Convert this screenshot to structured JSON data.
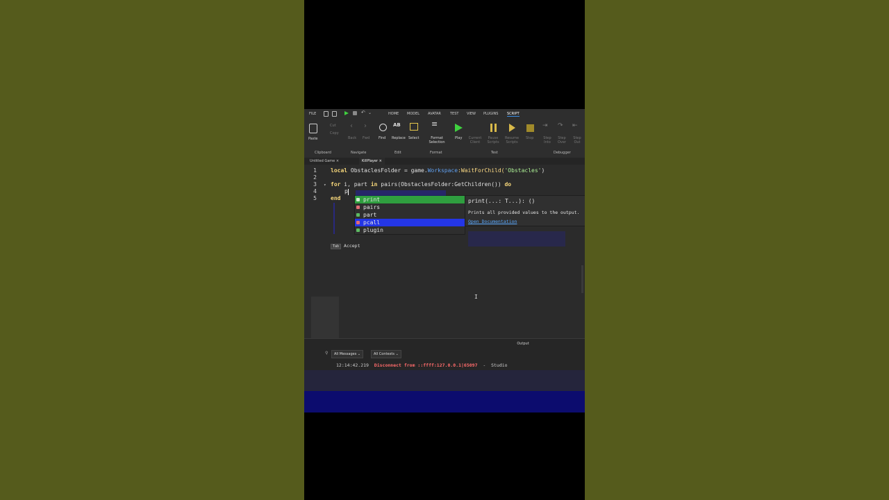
{
  "menu": {
    "file": "FILE",
    "tabs": [
      "HOME",
      "MODEL",
      "AVATAR",
      "TEST",
      "VIEW",
      "PLUGINS",
      "SCRIPT"
    ],
    "active": "SCRIPT"
  },
  "ribbon": {
    "paste": "Paste",
    "cut": "Cut",
    "copy": "Copy",
    "back": "Back",
    "fwd": "Fwd",
    "find": "Find",
    "replace": "Replace",
    "select": "Select",
    "format_selection": "Format Selection",
    "play": "Play",
    "current_client": "Current Client",
    "pause_scripts": "Pause Scripts",
    "resume_scripts": "Resume Scripts",
    "stop": "Stop",
    "step_into": "Step Into",
    "step_over": "Step Over",
    "step_out": "Step Out",
    "groups": {
      "clipboard": "Clipboard",
      "navigate": "Navigate",
      "edit": "Edit",
      "format": "Format",
      "test": "Test",
      "debugger": "Debugger"
    }
  },
  "tabs": [
    {
      "label": "Untitled Game",
      "close": "×"
    },
    {
      "label": "KillPlayer",
      "close": "×"
    }
  ],
  "editor": {
    "lines": [
      "1",
      "2",
      "3",
      "4",
      "5"
    ],
    "line1": {
      "kw": "local",
      "a": " ObstaclesFolder = game.",
      "prop": "Workspace",
      "b": ":WaitForChild(",
      "str": "'Obstacles'",
      "c": ")"
    },
    "line3": {
      "kw1": "for",
      "a": " i, part ",
      "kw2": "in",
      "b": " pairs(ObstaclesFolder:GetChildren()) ",
      "kw3": "do"
    },
    "line4": "p",
    "line5": "end"
  },
  "autocomplete": {
    "items": [
      {
        "label": "print",
        "kind": "function",
        "color": "#5dbb63"
      },
      {
        "label": "pairs",
        "kind": "function",
        "color": "#e06c75"
      },
      {
        "label": "part",
        "kind": "variable",
        "color": "#5dbb63"
      },
      {
        "label": "pcall",
        "kind": "function",
        "color": "#e06c75"
      },
      {
        "label": "plugin",
        "kind": "variable",
        "color": "#5dbb63"
      }
    ],
    "selected_index": 0,
    "signature": "print(...: T...): ()",
    "description": "Prints all provided values to the output.",
    "doc_link": "Open Documentation",
    "accept_key": "Tab",
    "accept_label": "Accept"
  },
  "output": {
    "title": "Output",
    "filter_messages": "All Messages",
    "filter_contexts": "All Contexts",
    "log": {
      "time": "12:14:42.219",
      "message": "Disconnect from ::ffff:127.0.0.1|65097",
      "sep": "-",
      "source": "Studio"
    }
  },
  "colors": {
    "background": "#555b1c",
    "selection_green": "#2f9e3f",
    "selection_blue": "#2436e6",
    "glitch_blue": "#2a2af0"
  }
}
